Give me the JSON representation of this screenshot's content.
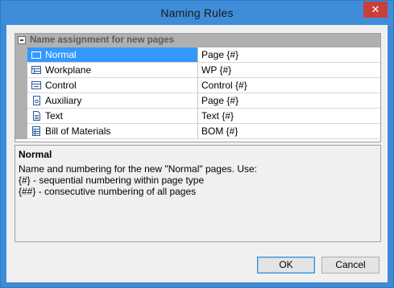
{
  "window": {
    "title": "Naming Rules",
    "close_glyph": "✕"
  },
  "grid": {
    "category": "Name assignment for new pages",
    "rows": [
      {
        "name": "Normal",
        "value": "Page {#}",
        "icon": "page-icon",
        "selected": true
      },
      {
        "name": "Workplane",
        "value": "WP {#}",
        "icon": "workplane-icon"
      },
      {
        "name": "Control",
        "value": "Control {#}",
        "icon": "control-icon"
      },
      {
        "name": "Auxiliary",
        "value": "Page {#}",
        "icon": "auxiliary-icon"
      },
      {
        "name": "Text",
        "value": "Text {#}",
        "icon": "text-doc-icon"
      },
      {
        "name": "Bill of Materials",
        "value": "BOM {#}",
        "icon": "bom-icon"
      }
    ]
  },
  "description": {
    "title": "Normal",
    "lines": [
      "Name and numbering for the new \"Normal\" pages. Use:",
      "{#} - sequential numbering within page type",
      "{##} - consecutive numbering of all pages"
    ]
  },
  "buttons": {
    "ok": "OK",
    "cancel": "Cancel"
  },
  "colors": {
    "title_bar": "#3f8dd9",
    "close_button": "#c8403a",
    "selection": "#3399ff"
  }
}
